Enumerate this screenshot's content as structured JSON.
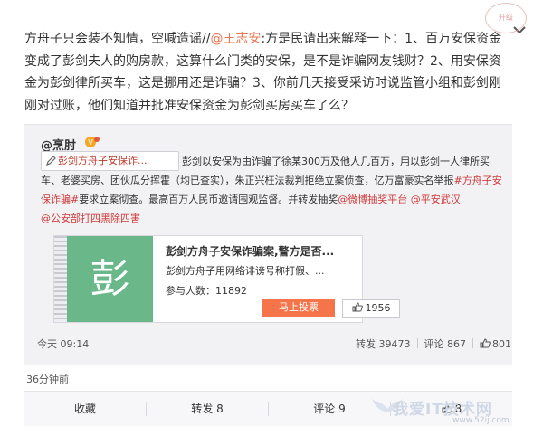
{
  "post": {
    "text_before_mention": "方舟子只会装不知情，空喊造谣//",
    "mention": "@王志安",
    "text_after_mention": ":方是民请出来解释一下：1、百万安保资金变成了彭剑夫人的购房款，这算什么门类的安保，是不是诈骗网友钱财？2、用安保资金为彭剑律所买车，这是挪用还是诈骗？3、你前几天接受采访时说监管小组和彭剑刚刚对过账，他们知道并批准安保资金为彭剑买房买车了么？",
    "time": "36分钟前"
  },
  "stamp": {
    "text": "升级"
  },
  "repost": {
    "author": "@烹肘",
    "topic_chip": "彭剑方舟子安保诈...",
    "body": "彭剑以安保为由诈骗了徐某300万及他人几百万，用以彭剑一人律所买车、老婆买房、团伙瓜分挥霍（均已查实），朱正兴枉法裁判拒绝立案侦查，亿万富豪实名举报",
    "body_tag": "#方舟子安保诈骗#",
    "body_mid": "要求立案彻查。最高百万人民币邀请围观监督。并转发抽奖",
    "body_links": [
      "@微博抽奖平台",
      "@平安武汉",
      "@公安部打四黑除四害"
    ],
    "card": {
      "thumb_char": "彭",
      "title": "彭剑方舟子安保诈骗案,警方是否...",
      "desc": "彭剑方舟子用网络诽谤号称打假、...",
      "participants_label": "参与人数：",
      "participants": "11892",
      "vote_button": "马上投票",
      "likes": "1956"
    },
    "time": "今天 09:14",
    "reposts_label": "转发",
    "reposts": "39473",
    "comments_label": "评论",
    "comments": "867",
    "likes": "801"
  },
  "actions": {
    "collect": "收藏",
    "forward": "转发 8",
    "comment": "评论 9",
    "like": "8"
  },
  "watermark": {
    "text": "我爱IT技术网",
    "url": "www.52ij.com"
  },
  "colors": {
    "link": "#eb7350",
    "tag_red": "#d03a3a",
    "vote": "#f5744a",
    "card_green": "#6ab88a"
  }
}
